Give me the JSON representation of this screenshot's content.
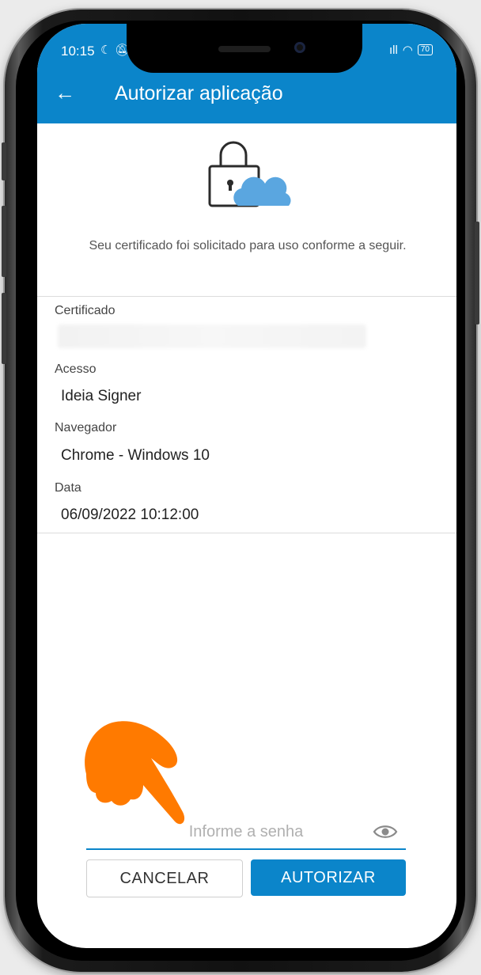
{
  "status": {
    "time": "10:15",
    "battery": "70"
  },
  "appbar": {
    "title": "Autorizar aplicação",
    "back_icon": "arrow-left-icon"
  },
  "intro_text": "Seu certificado foi solicitado para uso conforme a seguir.",
  "fields": [
    {
      "label": "Certificado",
      "value": ""
    },
    {
      "label": "Acesso",
      "value": "Ideia Signer"
    },
    {
      "label": "Navegador",
      "value": "Chrome - Windows 10"
    },
    {
      "label": "Data",
      "value": "06/09/2022 10:12:00"
    }
  ],
  "password": {
    "placeholder": "Informe a senha",
    "value": ""
  },
  "buttons": {
    "cancel": "CANCELAR",
    "authorize": "AUTORIZAR"
  },
  "colors": {
    "primary": "#0b85ca",
    "accent_hand": "#ff7a00",
    "cloud": "#5aa6e0"
  }
}
